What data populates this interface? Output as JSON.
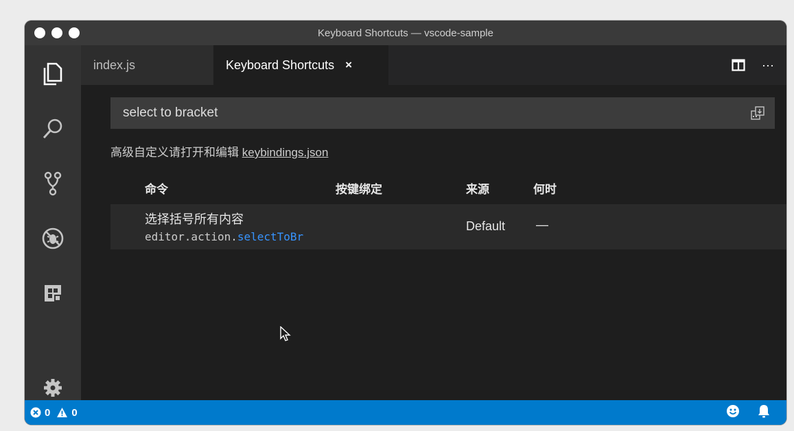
{
  "window": {
    "title": "Keyboard Shortcuts — vscode-sample"
  },
  "activity_bar": {
    "items": [
      {
        "name": "explorer",
        "icon": "files-icon"
      },
      {
        "name": "search",
        "icon": "search-icon"
      },
      {
        "name": "source-control",
        "icon": "git-branch-icon"
      },
      {
        "name": "debug",
        "icon": "no-bug-icon"
      },
      {
        "name": "extensions",
        "icon": "extensions-icon"
      },
      {
        "name": "settings",
        "icon": "gear-icon"
      }
    ]
  },
  "tabs": [
    {
      "label": "index.js",
      "active": false
    },
    {
      "label": "Keyboard Shortcuts",
      "active": true,
      "close": "×"
    }
  ],
  "tab_actions": {
    "split": "split-editor-icon",
    "more": "···"
  },
  "keybindings": {
    "search_value": "select to bracket",
    "advice_prefix": "高级自定义请打开和编辑",
    "advice_link": "keybindings.json",
    "columns": {
      "command": "命令",
      "keybinding": "按键绑定",
      "source": "来源",
      "when": "何时"
    },
    "rows": [
      {
        "title": "选择括号所有内容",
        "id_prefix": "editor.action.",
        "id_highlight": "selectToBr",
        "source": "Default",
        "when": "—"
      }
    ]
  },
  "status_bar": {
    "errors": "0",
    "warnings": "0",
    "feedback_icon": "smiley-icon",
    "notifications_icon": "bell-icon"
  },
  "colors": {
    "status_bar": "#007acc",
    "link_highlight": "#3794ff",
    "editor_bg": "#1e1e1e",
    "activity_bar": "#333333"
  }
}
